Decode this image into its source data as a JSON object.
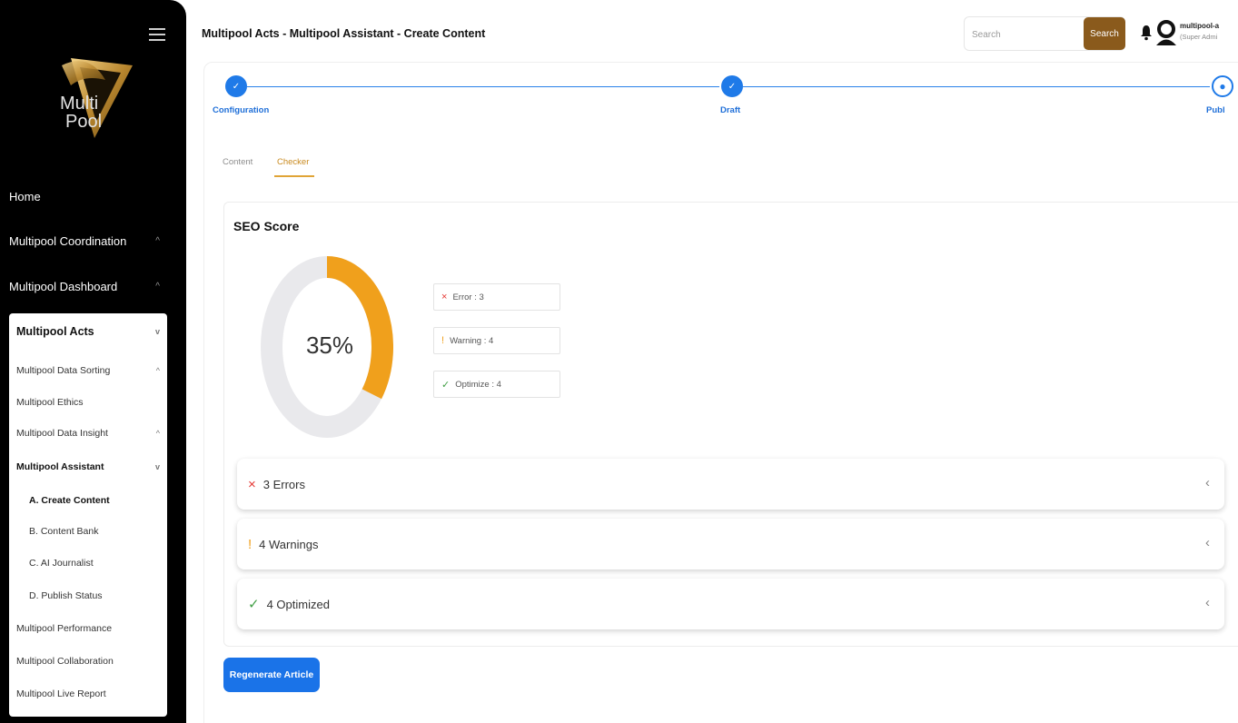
{
  "header": {
    "title": "Multipool Acts - Multipool Assistant - Create Content",
    "search_placeholder": "Search",
    "search_button": "Search",
    "user_name": "multipool-a",
    "user_role": "(Super Admi"
  },
  "logo": {
    "line1": "Multi",
    "line2": "Pool"
  },
  "sidebar": {
    "items": [
      {
        "label": "Home",
        "chevron": ""
      },
      {
        "label": "Multipool Coordination",
        "chevron": "^"
      },
      {
        "label": "Multipool Dashboard",
        "chevron": "^"
      }
    ],
    "acts": {
      "label": "Multipool Acts",
      "chevron": "v",
      "items": [
        {
          "label": "Multipool Data Sorting",
          "chevron": "^"
        },
        {
          "label": "Multipool Ethics",
          "chevron": ""
        },
        {
          "label": "Multipool Data Insight",
          "chevron": "^"
        },
        {
          "label": "Multipool Assistant",
          "chevron": "v"
        },
        {
          "label": "A. Create Content",
          "chevron": ""
        },
        {
          "label": "B. Content Bank",
          "chevron": ""
        },
        {
          "label": "C. AI Journalist",
          "chevron": ""
        },
        {
          "label": "D. Publish Status",
          "chevron": ""
        },
        {
          "label": "Multipool Performance",
          "chevron": ""
        },
        {
          "label": "Multipool Collaboration",
          "chevron": ""
        },
        {
          "label": "Multipool Live Report",
          "chevron": ""
        }
      ]
    }
  },
  "stepper": {
    "steps": [
      {
        "label": "Configuration",
        "icon": "✓"
      },
      {
        "label": "Draft",
        "icon": "✓"
      },
      {
        "label": "Publ",
        "icon": "●"
      }
    ]
  },
  "tabs": [
    {
      "label": "Content"
    },
    {
      "label": "Checker"
    }
  ],
  "seo": {
    "title": "SEO Score",
    "score_label": "35%",
    "score": 35,
    "colors": {
      "filled": "#f0a01c",
      "track": "#e9e9ec"
    },
    "legend": [
      {
        "icon": "×",
        "label": "Error : 3",
        "color": "#e53935"
      },
      {
        "icon": "!",
        "label": "Warning : 4",
        "color": "#f0a01c"
      },
      {
        "icon": "✓",
        "label": "Optimize : 4",
        "color": "#43a047"
      }
    ]
  },
  "accordions": [
    {
      "icon": "×",
      "label": "3 Errors",
      "color": "#e53935",
      "chevron": "‹"
    },
    {
      "icon": "!",
      "label": "4 Warnings",
      "color": "#f0a01c",
      "chevron": "‹"
    },
    {
      "icon": "✓",
      "label": "4 Optimized",
      "color": "#43a047",
      "chevron": "‹"
    }
  ],
  "regenerate_button": "Regenerate Article"
}
